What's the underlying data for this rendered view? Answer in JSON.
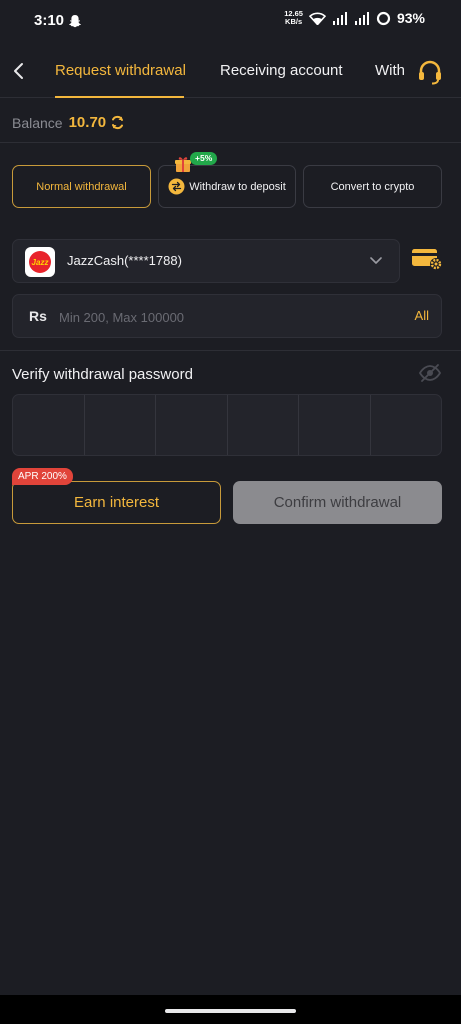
{
  "status": {
    "time": "3:10",
    "net_speed_top": "12.65",
    "net_speed_bottom": "KB/s",
    "battery": "93%"
  },
  "nav": {
    "tabs": [
      {
        "label": "Request withdrawal",
        "active": true
      },
      {
        "label": "Receiving account",
        "active": false
      },
      {
        "label": "With",
        "active": false
      }
    ]
  },
  "balance": {
    "label": "Balance",
    "value": "10.70"
  },
  "methods": [
    {
      "label": "Normal withdrawal",
      "active": true
    },
    {
      "label": "Withdraw to deposit",
      "active": false,
      "badge": "+5%"
    },
    {
      "label": "Convert to crypto",
      "active": false
    }
  ],
  "account": {
    "name": "JazzCash(****1788)",
    "logo_text": "Jazz"
  },
  "amount": {
    "currency": "Rs",
    "placeholder": "Min 200, Max 100000",
    "all_label": "All"
  },
  "password": {
    "label": "Verify withdrawal password",
    "cells": 6
  },
  "actions": {
    "earn_label": "Earn interest",
    "earn_badge": "APR 200%",
    "confirm_label": "Confirm withdrawal"
  },
  "colors": {
    "accent": "#f3b73d",
    "background": "#1c1d23",
    "badge_green": "#22a84a",
    "badge_red": "#e1443a"
  }
}
